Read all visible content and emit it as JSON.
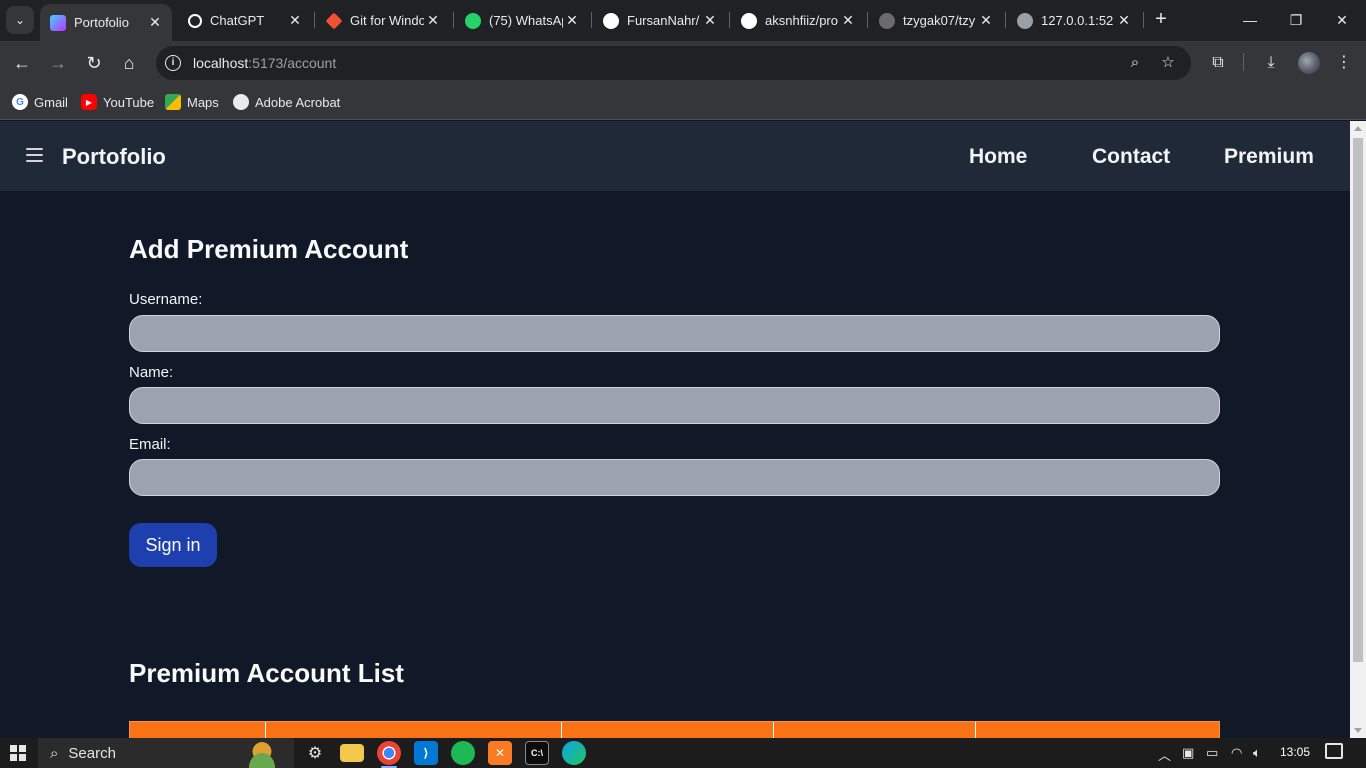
{
  "browser": {
    "tabs": [
      {
        "title": "Portofolio",
        "active": true,
        "icon": "vite-icon",
        "color": "#a855f7"
      },
      {
        "title": "ChatGPT",
        "active": false,
        "icon": "chatgpt-icon",
        "color": "#ffffff"
      },
      {
        "title": "Git for Windo",
        "active": false,
        "icon": "git-icon",
        "color": "#f05133"
      },
      {
        "title": "(75) WhatsAp",
        "active": false,
        "icon": "whatsapp-icon",
        "color": "#25d366"
      },
      {
        "title": "FursanNahr/",
        "active": false,
        "icon": "github-icon",
        "color": "#ffffff"
      },
      {
        "title": "aksnhfiiz/pro",
        "active": false,
        "icon": "github-icon",
        "color": "#ffffff"
      },
      {
        "title": "tzygak07/tzy",
        "active": false,
        "icon": "github-icon",
        "color": "#6b6b6b"
      },
      {
        "title": "127.0.0.1:52",
        "active": false,
        "icon": "globe-icon",
        "color": "#9aa0a6"
      }
    ],
    "address": {
      "host": "localhost",
      "path": ":5173/account"
    },
    "bookmarks": [
      {
        "label": "Gmail",
        "icon": "google-icon"
      },
      {
        "label": "YouTube",
        "icon": "youtube-icon"
      },
      {
        "label": "Maps",
        "icon": "maps-icon"
      },
      {
        "label": "Adobe Acrobat",
        "icon": "globe-icon"
      }
    ]
  },
  "app": {
    "brand": "Portofolio",
    "nav": {
      "home": "Home",
      "contact": "Contact",
      "premium": "Premium"
    }
  },
  "form": {
    "title": "Add Premium Account",
    "username_label": "Username:",
    "username_value": "",
    "name_label": "Name:",
    "name_value": "",
    "email_label": "Email:",
    "email_value": "",
    "submit_label": "Sign in"
  },
  "list": {
    "title": "Premium Account List",
    "header_color": "#f97316"
  },
  "taskbar": {
    "search_label": "Search",
    "clock": "13:05"
  },
  "colors": {
    "page_bg": "#111827",
    "nav_bg": "#1f2937",
    "input_bg": "#9ca3af",
    "button_bg": "#1e40af"
  }
}
